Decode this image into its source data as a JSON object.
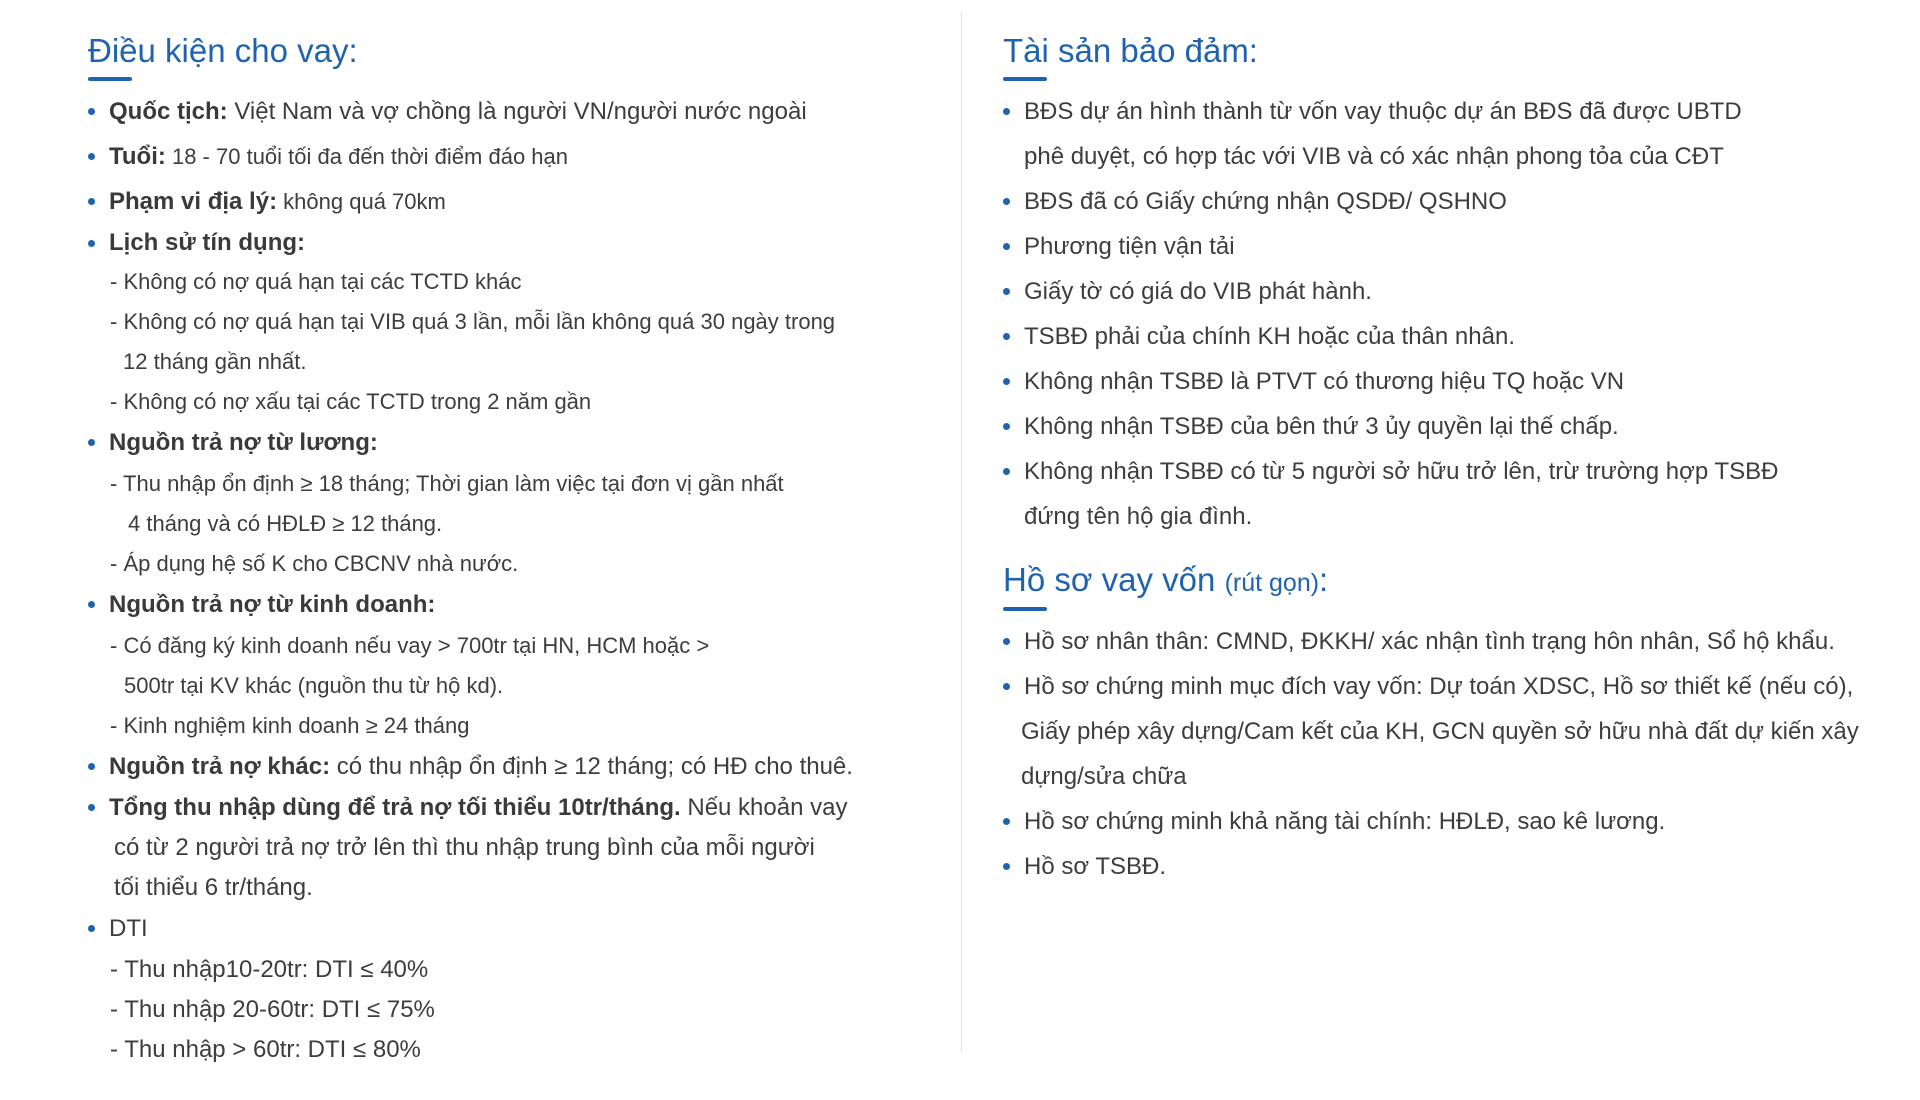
{
  "left": {
    "title": "Điều kiện cho vay:",
    "items": [
      {
        "label": "Quốc tịch:",
        "text": " Việt Nam và vợ chồng là người VN/người nước ngoài"
      },
      {
        "label": "Tuổi:",
        "text": " 18 - 70 tuổi tối đa đến thời điểm đáo hạn"
      },
      {
        "label": "Phạm vi địa lý:",
        "text": " không quá 70km"
      },
      {
        "label": "Lịch sử tín dụng:",
        "text": ""
      }
    ],
    "credit_history": [
      "- Không có nợ quá hạn tại các TCTD khác",
      "- Không có nợ quá hạn tại VIB quá 3 lần, mỗi lần không quá 30 ngày trong",
      "12 tháng gần nhất.",
      "- Không có nợ xấu tại các TCTD trong 2 năm gần"
    ],
    "salary_label": "Nguồn trả nợ từ lương:",
    "salary": [
      "- Thu nhập ổn định ≥ 18 tháng; Thời gian làm việc tại đơn vị gần nhất",
      "4 tháng và có HĐLĐ ≥ 12 tháng.",
      "- Áp dụng hệ số K cho CBCNV nhà nước."
    ],
    "business_label": "Nguồn trả nợ từ kinh doanh:",
    "business": [
      "- Có đăng ký kinh doanh nếu vay > 700tr tại HN, HCM hoặc >",
      "500tr tại KV khác (nguồn thu từ hộ kd).",
      "- Kinh nghiệm kinh doanh ≥ 24 tháng"
    ],
    "other_label": "Nguồn trả nợ khác:",
    "other_text": " có thu nhập ổn định ≥ 12 tháng; có HĐ cho thuê.",
    "total_label": "Tổng thu nhập dùng để trả nợ tối thiểu 10tr/tháng.",
    "total_text": " Nếu khoản vay",
    "total_cont": [
      "có từ 2 người trả nợ trở lên thì thu nhập trung bình của mỗi người",
      "tối thiểu 6 tr/tháng."
    ],
    "dti_label": "DTI",
    "dti": [
      "- Thu nhập10-20tr: DTI ≤ 40%",
      "- Thu nhập 20-60tr: DTI ≤ 75%",
      "- Thu nhập > 60tr: DTI ≤ 80%"
    ]
  },
  "right": {
    "title": "Tài sản bảo đảm:",
    "collateral": [
      [
        "BĐS dự án hình thành từ vốn vay thuộc dự án BĐS đã được UBTD",
        "phê duyệt, có hợp tác với VIB và có xác nhận phong tỏa của CĐT"
      ],
      [
        "BĐS đã có Giấy chứng nhận QSDĐ/ QSHNO"
      ],
      [
        "Phương tiện vận tải"
      ],
      [
        "Giấy tờ có giá do VIB phát hành."
      ],
      [
        "TSBĐ phải của chính KH hoặc của thân nhân."
      ],
      [
        "Không nhận TSBĐ là PTVT có thương hiệu TQ hoặc VN"
      ],
      [
        "Không nhận TSBĐ của bên thứ 3 ủy quyền lại thế chấp."
      ],
      [
        "Không nhận TSBĐ có từ 5 người sở hữu trở lên, trừ trường hợp TSBĐ",
        "đứng tên hộ gia đình."
      ]
    ],
    "docs_title": "Hồ sơ vay vốn",
    "docs_title_small": "(rút gọn)",
    "docs_title_colon": ":",
    "docs": [
      [
        "Hồ sơ nhân thân: CMND, ĐKKH/ xác nhận tình trạng hôn nhân, Sổ hộ khẩu."
      ],
      [
        "Hồ sơ chứng minh mục đích vay vốn: Dự toán XDSC, Hồ sơ thiết kế (nếu có),",
        "Giấy phép xây dựng/Cam kết của KH, GCN quyền sở hữu nhà đất dự kiến xây",
        "dựng/sửa chữa"
      ],
      [
        "Hồ sơ chứng minh khả năng tài chính: HĐLĐ, sao kê lương."
      ],
      [
        "Hồ sơ TSBĐ."
      ]
    ]
  }
}
